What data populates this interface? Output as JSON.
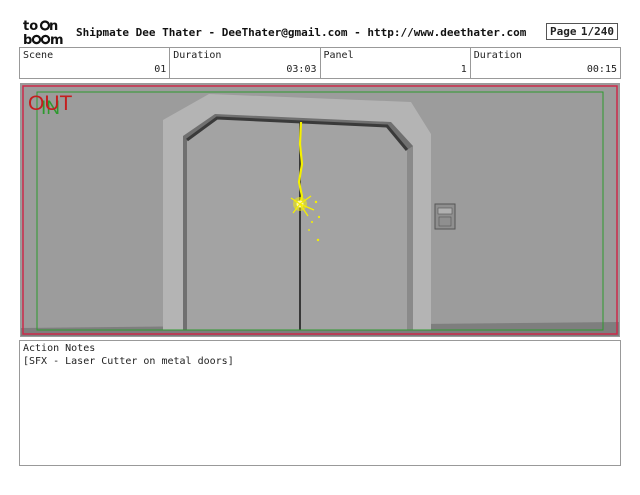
{
  "header": {
    "logo_text": "toon boom",
    "title": "Shipmate  Dee Thater - DeeThater@gmail.com - http://www.deethater.com",
    "page_label": "Page",
    "page_value": "1/240"
  },
  "info": [
    {
      "label": "Scene",
      "value": "01"
    },
    {
      "label": "Duration",
      "value": "03:03"
    },
    {
      "label": "Panel",
      "value": "1"
    },
    {
      "label": "Duration",
      "value": "00:15"
    }
  ],
  "panel": {
    "out_label": "OUT",
    "in_label": "IN",
    "colors": {
      "out": "#c41e1e",
      "in": "#2e9a2e",
      "laser": "#f5f000",
      "frame": "#cc2a4a"
    }
  },
  "notes": {
    "label": "Action Notes",
    "text": "[SFX - Laser Cutter on metal doors]"
  }
}
